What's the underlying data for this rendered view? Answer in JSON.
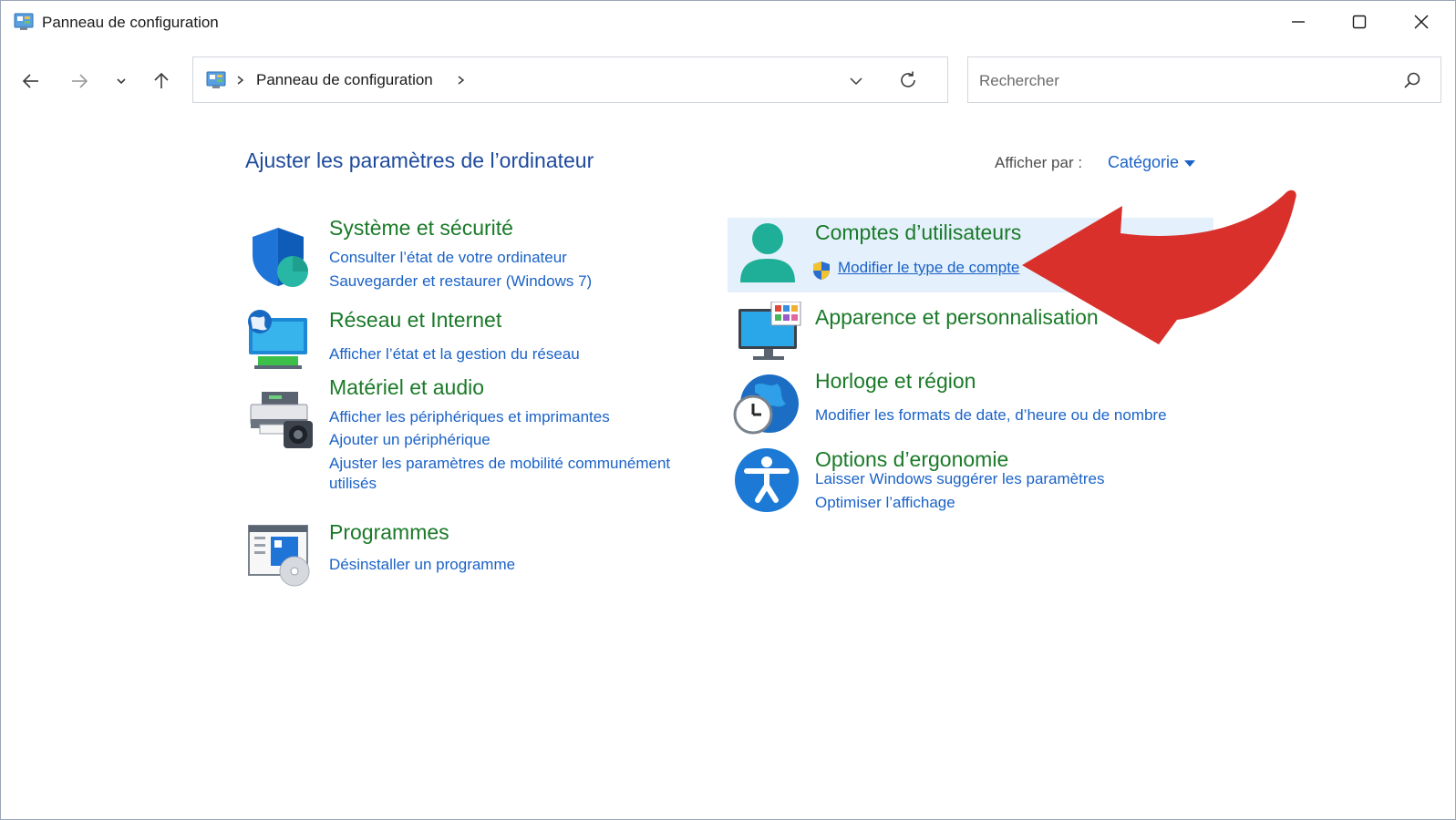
{
  "window": {
    "title": "Panneau de configuration",
    "controls": {
      "minimize": "minimize-icon",
      "maximize": "maximize-icon",
      "close": "close-icon"
    }
  },
  "nav": {
    "back": "back-arrow-icon",
    "forward": "forward-arrow-icon",
    "recent": "chevron-down-icon",
    "up": "up-arrow-icon"
  },
  "address": {
    "location": "Panneau de configuration"
  },
  "search": {
    "placeholder": "Rechercher"
  },
  "header": {
    "title": "Ajuster les paramètres de l’ordinateur",
    "view_by_label": "Afficher par :",
    "view_by_value": "Catégorie"
  },
  "categories_left": [
    {
      "title": "Système et sécurité",
      "icon": "shield-icon",
      "links": [
        "Consulter l’état de votre ordinateur",
        "Sauvegarder et restaurer (Windows 7)"
      ]
    },
    {
      "title": "Réseau et Internet",
      "icon": "network-icon",
      "links": [
        "Afficher l’état et la gestion du réseau"
      ]
    },
    {
      "title": "Matériel et audio",
      "icon": "printer-icon",
      "links": [
        "Afficher les périphériques et imprimantes",
        "Ajouter un périphérique",
        "Ajuster les paramètres de mobilité communément",
        "utilisés"
      ]
    },
    {
      "title": "Programmes",
      "icon": "programs-icon",
      "links": [
        "Désinstaller un programme"
      ]
    }
  ],
  "categories_right": [
    {
      "title": "Comptes d’utilisateurs",
      "icon": "user-icon",
      "links": [
        "Modifier le type de compte"
      ]
    },
    {
      "title": "Apparence et personnalisation",
      "icon": "monitor-icon",
      "links": []
    },
    {
      "title": "Horloge et région",
      "icon": "clock-globe-icon",
      "links": [
        "Modifier les formats de date, d’heure ou de nombre"
      ]
    },
    {
      "title": "Options d’ergonomie",
      "icon": "accessibility-icon",
      "links": [
        "Laisser Windows suggérer les paramètres",
        "Optimiser l’affichage"
      ]
    }
  ],
  "colors": {
    "title_blue": "#1e4a9c",
    "link_blue": "#1a62c7",
    "category_green": "#1a7a28",
    "highlight": "#e4f0fc",
    "annotation_red": "#d9302b"
  }
}
